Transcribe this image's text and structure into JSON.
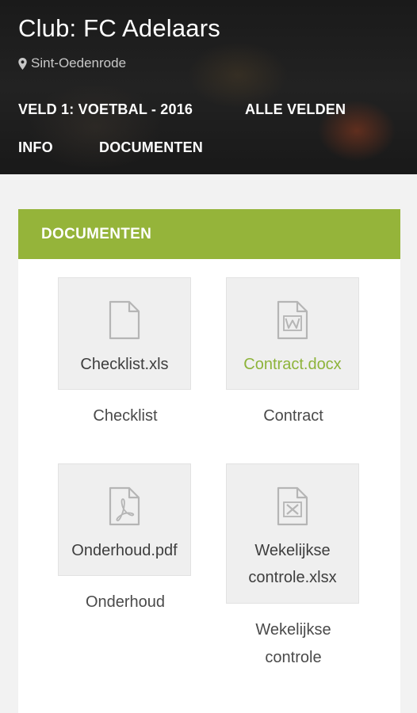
{
  "header": {
    "club_title": "Club: FC Adelaars",
    "location": "Sint-Oedenrode",
    "location_icon": "map-marker-icon"
  },
  "nav": {
    "field": "VELD 1: VOETBAL - 2016",
    "all_fields": "ALLE VELDEN",
    "info": "INFO",
    "documents": "DOCUMENTEN"
  },
  "panel": {
    "title": "DOCUMENTEN"
  },
  "documents": [
    {
      "filename": "Checklist.xls",
      "caption": "Checklist",
      "icon": "file-icon"
    },
    {
      "filename": "Contract.docx",
      "caption": "Contract",
      "icon": "word-file-icon"
    },
    {
      "filename": "Onderhoud.pdf",
      "caption": "Onderhoud",
      "icon": "pdf-file-icon"
    },
    {
      "filename_line1": "Wekelijkse",
      "filename_line2": "controle.xlsx",
      "caption_line1": "Wekelijkse",
      "caption_line2": "controle",
      "icon": "excel-file-icon"
    }
  ],
  "colors": {
    "accent": "#95b43a",
    "link_green": "#8db33a",
    "tile_bg": "#efefef"
  }
}
